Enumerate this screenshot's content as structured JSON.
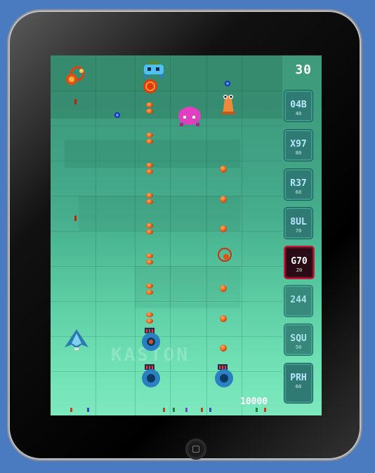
{
  "game": {
    "wave_counter": "30",
    "high_score": "10000",
    "watermark": "KASTON"
  },
  "towers": [
    {
      "code": "04B",
      "cost": "40",
      "selected": false
    },
    {
      "code": "X97",
      "cost": "80",
      "selected": false
    },
    {
      "code": "R37",
      "cost": "60",
      "selected": false
    },
    {
      "code": "8UL",
      "cost": "70",
      "selected": false
    },
    {
      "code": "G70",
      "cost": "20",
      "selected": true
    },
    {
      "code": "244",
      "cost": "",
      "selected": false
    },
    {
      "code": "SQU",
      "cost": "50",
      "selected": false
    },
    {
      "code": "PRH",
      "cost": "60",
      "selected": false
    }
  ],
  "colors": {
    "background": "#4a7ac0",
    "bullet": "#e05010",
    "tower_selected_border": "#c02040",
    "score_text": "#ffffff"
  }
}
